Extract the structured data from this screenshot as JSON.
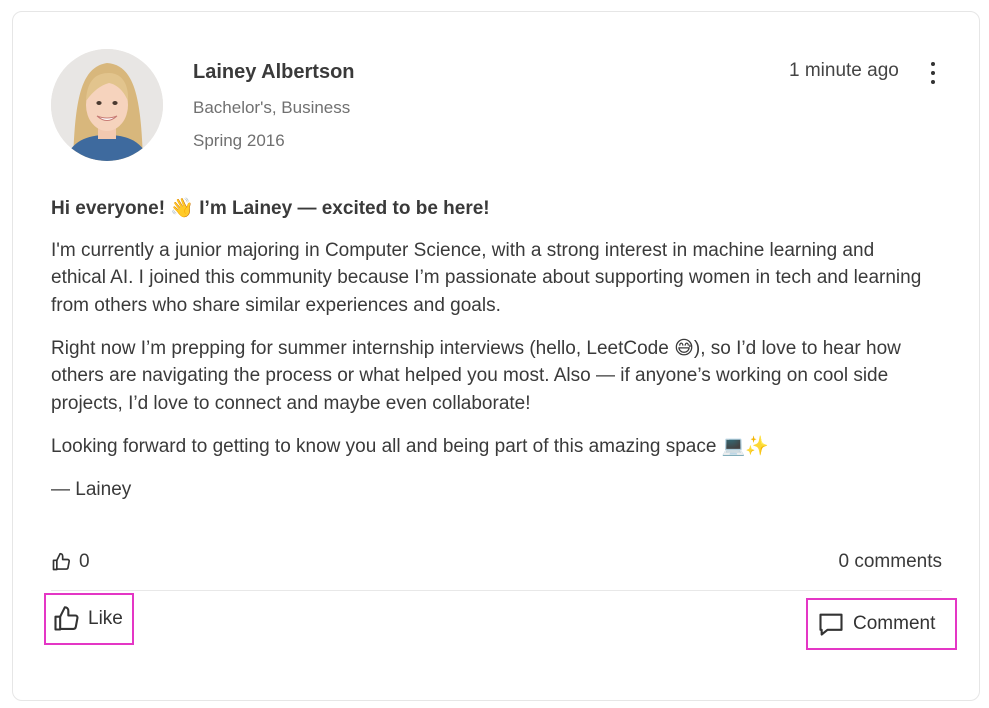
{
  "post": {
    "author": {
      "name": "Lainey Albertson",
      "degree": "Bachelor's, Business",
      "term": "Spring 2016",
      "avatar_icon": "profile-photo"
    },
    "timestamp": "1 minute ago",
    "more_icon": "vertical-ellipsis-icon",
    "body": {
      "greeting": "Hi everyone! 👋 I’m Lainey — excited to be here!",
      "paragraph_1": "I'm currently a junior majoring in Computer Science, with a strong interest in machine learning and ethical AI. I joined this community because I’m passionate about supporting women in tech and learning from others who share similar experiences and goals.",
      "paragraph_2": "Right now I’m prepping for summer internship interviews (hello, LeetCode 😅), so I’d love to hear how others are navigating the process or what helped you most. Also — if anyone’s working on cool side projects, I’d love to connect and maybe even collaborate!",
      "paragraph_3": "Looking forward to getting to know you all and being part of this amazing space 💻✨",
      "signature": "— Lainey"
    },
    "stats": {
      "like_count": "0",
      "comments": "0 comments"
    },
    "actions": {
      "like_label": "Like",
      "comment_label": "Comment"
    },
    "colors": {
      "highlight_border": "#e436c5",
      "text": "#3a3a3a",
      "muted_text": "#707070"
    }
  }
}
